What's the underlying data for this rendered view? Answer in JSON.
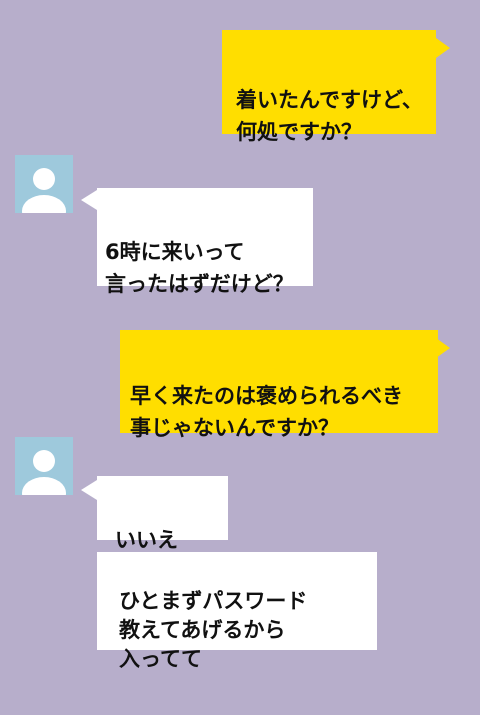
{
  "chat": {
    "messages": [
      {
        "side": "right",
        "text": "着いたんですけど、\n何処ですか？"
      },
      {
        "side": "left",
        "text": "6時に来いって\n言ったはずだけど？"
      },
      {
        "side": "right",
        "text": "早く来たのは褒められるべき\n事じゃないんですか？"
      },
      {
        "side": "left",
        "text": "いいえ"
      },
      {
        "side": "left",
        "text": "ひとまずパスワード\n教えてあげるから\n入ってて"
      }
    ]
  },
  "colors": {
    "background": "#b7aecb",
    "sent_bubble": "#ffde00",
    "received_bubble": "#ffffff",
    "avatar_bg": "#9ec9dc"
  },
  "icons": {
    "avatar": "user-avatar-icon"
  }
}
